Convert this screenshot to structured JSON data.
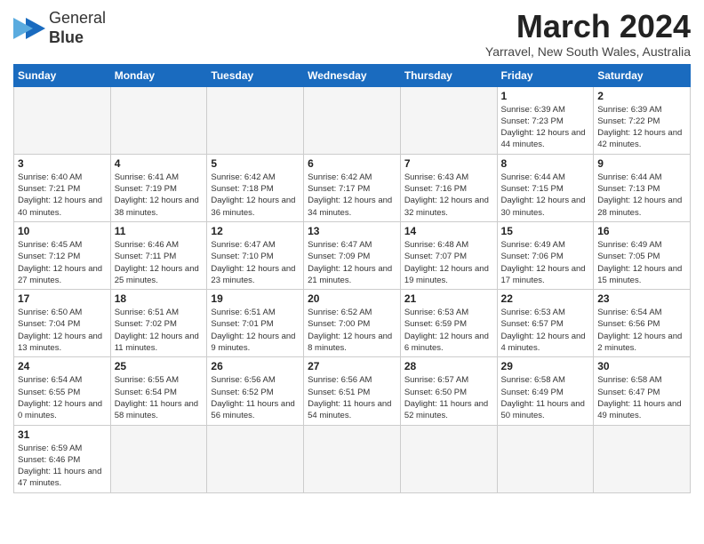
{
  "header": {
    "logo_text_normal": "General",
    "logo_text_bold": "Blue",
    "month_title": "March 2024",
    "location": "Yarravel, New South Wales, Australia"
  },
  "weekdays": [
    "Sunday",
    "Monday",
    "Tuesday",
    "Wednesday",
    "Thursday",
    "Friday",
    "Saturday"
  ],
  "weeks": [
    [
      {
        "day": "",
        "info": ""
      },
      {
        "day": "",
        "info": ""
      },
      {
        "day": "",
        "info": ""
      },
      {
        "day": "",
        "info": ""
      },
      {
        "day": "",
        "info": ""
      },
      {
        "day": "1",
        "info": "Sunrise: 6:39 AM\nSunset: 7:23 PM\nDaylight: 12 hours and 44 minutes."
      },
      {
        "day": "2",
        "info": "Sunrise: 6:39 AM\nSunset: 7:22 PM\nDaylight: 12 hours and 42 minutes."
      }
    ],
    [
      {
        "day": "3",
        "info": "Sunrise: 6:40 AM\nSunset: 7:21 PM\nDaylight: 12 hours and 40 minutes."
      },
      {
        "day": "4",
        "info": "Sunrise: 6:41 AM\nSunset: 7:19 PM\nDaylight: 12 hours and 38 minutes."
      },
      {
        "day": "5",
        "info": "Sunrise: 6:42 AM\nSunset: 7:18 PM\nDaylight: 12 hours and 36 minutes."
      },
      {
        "day": "6",
        "info": "Sunrise: 6:42 AM\nSunset: 7:17 PM\nDaylight: 12 hours and 34 minutes."
      },
      {
        "day": "7",
        "info": "Sunrise: 6:43 AM\nSunset: 7:16 PM\nDaylight: 12 hours and 32 minutes."
      },
      {
        "day": "8",
        "info": "Sunrise: 6:44 AM\nSunset: 7:15 PM\nDaylight: 12 hours and 30 minutes."
      },
      {
        "day": "9",
        "info": "Sunrise: 6:44 AM\nSunset: 7:13 PM\nDaylight: 12 hours and 28 minutes."
      }
    ],
    [
      {
        "day": "10",
        "info": "Sunrise: 6:45 AM\nSunset: 7:12 PM\nDaylight: 12 hours and 27 minutes."
      },
      {
        "day": "11",
        "info": "Sunrise: 6:46 AM\nSunset: 7:11 PM\nDaylight: 12 hours and 25 minutes."
      },
      {
        "day": "12",
        "info": "Sunrise: 6:47 AM\nSunset: 7:10 PM\nDaylight: 12 hours and 23 minutes."
      },
      {
        "day": "13",
        "info": "Sunrise: 6:47 AM\nSunset: 7:09 PM\nDaylight: 12 hours and 21 minutes."
      },
      {
        "day": "14",
        "info": "Sunrise: 6:48 AM\nSunset: 7:07 PM\nDaylight: 12 hours and 19 minutes."
      },
      {
        "day": "15",
        "info": "Sunrise: 6:49 AM\nSunset: 7:06 PM\nDaylight: 12 hours and 17 minutes."
      },
      {
        "day": "16",
        "info": "Sunrise: 6:49 AM\nSunset: 7:05 PM\nDaylight: 12 hours and 15 minutes."
      }
    ],
    [
      {
        "day": "17",
        "info": "Sunrise: 6:50 AM\nSunset: 7:04 PM\nDaylight: 12 hours and 13 minutes."
      },
      {
        "day": "18",
        "info": "Sunrise: 6:51 AM\nSunset: 7:02 PM\nDaylight: 12 hours and 11 minutes."
      },
      {
        "day": "19",
        "info": "Sunrise: 6:51 AM\nSunset: 7:01 PM\nDaylight: 12 hours and 9 minutes."
      },
      {
        "day": "20",
        "info": "Sunrise: 6:52 AM\nSunset: 7:00 PM\nDaylight: 12 hours and 8 minutes."
      },
      {
        "day": "21",
        "info": "Sunrise: 6:53 AM\nSunset: 6:59 PM\nDaylight: 12 hours and 6 minutes."
      },
      {
        "day": "22",
        "info": "Sunrise: 6:53 AM\nSunset: 6:57 PM\nDaylight: 12 hours and 4 minutes."
      },
      {
        "day": "23",
        "info": "Sunrise: 6:54 AM\nSunset: 6:56 PM\nDaylight: 12 hours and 2 minutes."
      }
    ],
    [
      {
        "day": "24",
        "info": "Sunrise: 6:54 AM\nSunset: 6:55 PM\nDaylight: 12 hours and 0 minutes."
      },
      {
        "day": "25",
        "info": "Sunrise: 6:55 AM\nSunset: 6:54 PM\nDaylight: 11 hours and 58 minutes."
      },
      {
        "day": "26",
        "info": "Sunrise: 6:56 AM\nSunset: 6:52 PM\nDaylight: 11 hours and 56 minutes."
      },
      {
        "day": "27",
        "info": "Sunrise: 6:56 AM\nSunset: 6:51 PM\nDaylight: 11 hours and 54 minutes."
      },
      {
        "day": "28",
        "info": "Sunrise: 6:57 AM\nSunset: 6:50 PM\nDaylight: 11 hours and 52 minutes."
      },
      {
        "day": "29",
        "info": "Sunrise: 6:58 AM\nSunset: 6:49 PM\nDaylight: 11 hours and 50 minutes."
      },
      {
        "day": "30",
        "info": "Sunrise: 6:58 AM\nSunset: 6:47 PM\nDaylight: 11 hours and 49 minutes."
      }
    ],
    [
      {
        "day": "31",
        "info": "Sunrise: 6:59 AM\nSunset: 6:46 PM\nDaylight: 11 hours and 47 minutes."
      },
      {
        "day": "",
        "info": ""
      },
      {
        "day": "",
        "info": ""
      },
      {
        "day": "",
        "info": ""
      },
      {
        "day": "",
        "info": ""
      },
      {
        "day": "",
        "info": ""
      },
      {
        "day": "",
        "info": ""
      }
    ]
  ]
}
